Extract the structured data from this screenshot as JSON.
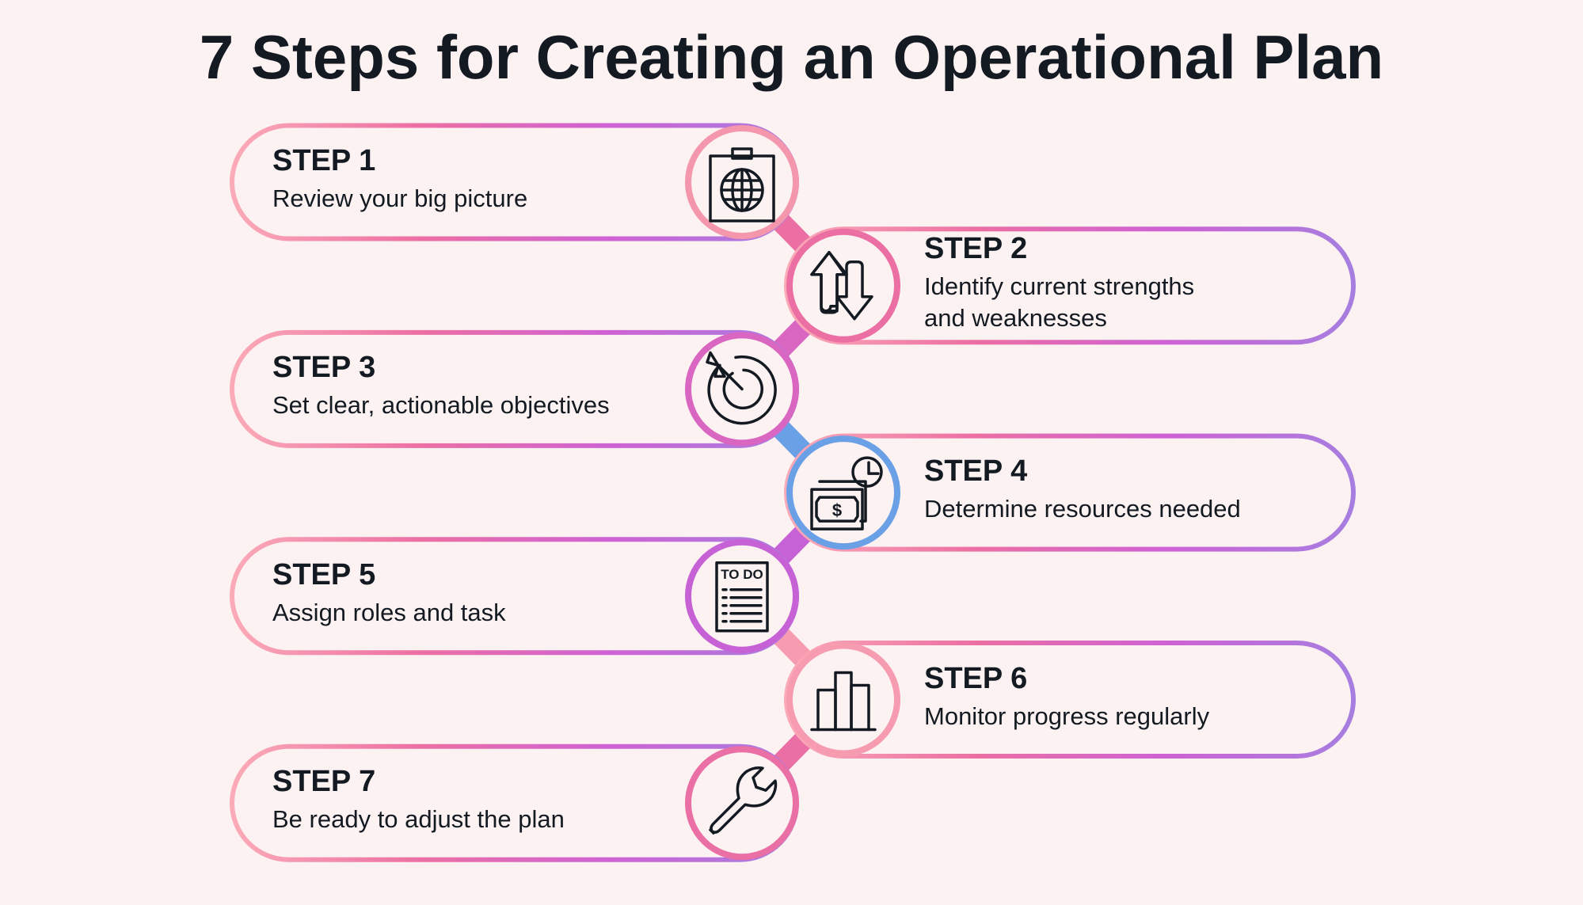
{
  "title": "7 Steps for Creating an Operational Plan",
  "colors": {
    "background": "#fdf2f2",
    "text": "#141a22",
    "gradient": [
      "#fbaab7",
      "#ec6fa3",
      "#cf62d4",
      "#a67ee0"
    ]
  },
  "steps": [
    {
      "label": "STEP 1",
      "description": [
        "Review your big picture"
      ],
      "icon": "globe-clipboard-icon",
      "side": "left",
      "ring_color": "#f497ad"
    },
    {
      "label": "STEP 2",
      "description": [
        "Identify current strengths",
        "and weaknesses"
      ],
      "icon": "up-down-arrows-icon",
      "side": "right",
      "ring_color": "#ec6fa3"
    },
    {
      "label": "STEP 3",
      "description": [
        "Set clear, actionable objectives"
      ],
      "icon": "target-arrow-icon",
      "side": "left",
      "ring_color": "#d966c0"
    },
    {
      "label": "STEP 4",
      "description": [
        "Determine resources needed"
      ],
      "icon": "money-clock-icon",
      "side": "right",
      "ring_color": "#6aa0e6"
    },
    {
      "label": "STEP 5",
      "description": [
        "Assign roles and task"
      ],
      "icon": "todo-list-icon",
      "side": "left",
      "ring_color": "#c762d6"
    },
    {
      "label": "STEP 6",
      "description": [
        "Monitor progress regularly"
      ],
      "icon": "bar-chart-icon",
      "side": "right",
      "ring_color": "#f69bb0"
    },
    {
      "label": "STEP 7",
      "description": [
        "Be ready to adjust the plan"
      ],
      "icon": "wrench-icon",
      "side": "left",
      "ring_color": "#ea6fa5"
    }
  ],
  "icon_todo_text": "TO DO"
}
